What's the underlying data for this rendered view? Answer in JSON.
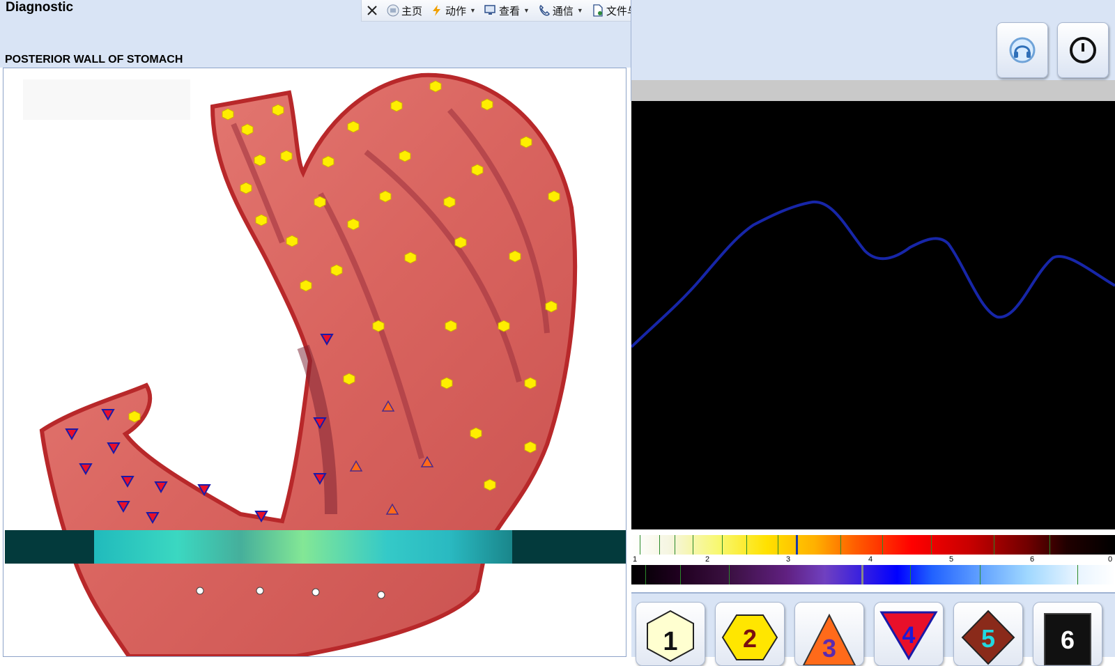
{
  "app": {
    "title": "Diagnostic"
  },
  "toolbar": {
    "items": [
      {
        "label": "",
        "icon": "close-icon"
      },
      {
        "label": "主页",
        "icon": "home-icon"
      },
      {
        "label": "动作",
        "icon": "lightning-icon"
      },
      {
        "label": "查看",
        "icon": "monitor-icon"
      },
      {
        "label": "通信",
        "icon": "phone-icon"
      },
      {
        "label": "文件与其他",
        "icon": "file-icon"
      },
      {
        "label": "",
        "icon": "chat-icon"
      },
      {
        "label": "",
        "icon": "smiley-icon"
      }
    ]
  },
  "section": {
    "title": "POSTERIOR WALL OF STOMACH"
  },
  "colors": {
    "background": "#d9e4f5",
    "marker_yellow": "#ffee00",
    "marker_red": "#e8102a",
    "marker_blue_outline": "#1a1aa8",
    "marker_orange": "#ff6a1a",
    "wave_line": "#1726a8",
    "scan_band": "#033a3c"
  },
  "spectrum": {
    "scale_labels": [
      "1",
      "2",
      "3",
      "4",
      "5",
      "6",
      "0"
    ]
  },
  "symbols": [
    {
      "label": "1",
      "shape": "hexagon",
      "fill": "#ffffd0"
    },
    {
      "label": "2",
      "shape": "hexagon",
      "fill": "#ffe600"
    },
    {
      "label": "3",
      "shape": "triangle-up",
      "fill": "#ff6a1a"
    },
    {
      "label": "4",
      "shape": "triangle-down",
      "fill": "#e8102a"
    },
    {
      "label": "5",
      "shape": "diamond",
      "fill": "#8a2a1a"
    },
    {
      "label": "6",
      "shape": "square",
      "fill": "#111111"
    }
  ]
}
